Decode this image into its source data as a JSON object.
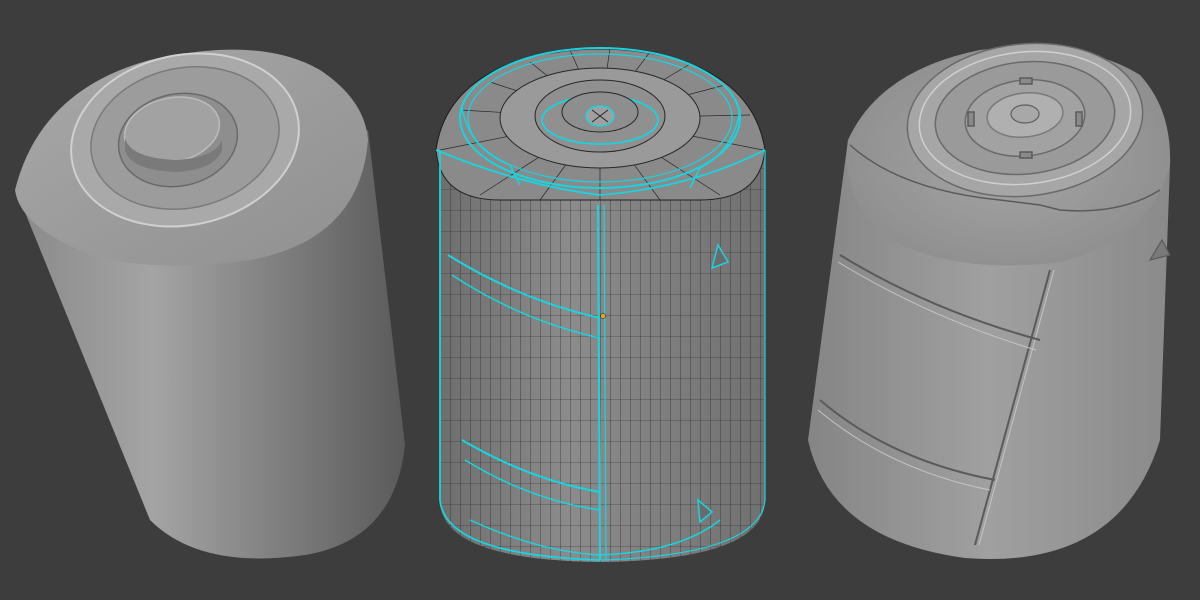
{
  "scene": {
    "background_color": "#3d3d3d",
    "objects": [
      {
        "id": "can-left",
        "description_icon": "cylinder-mesh-icon",
        "mode": "smooth-shaded"
      },
      {
        "id": "can-middle",
        "description_icon": "wireframe-mesh-icon",
        "mode": "edit-mode",
        "seam_color": "#19d4e0",
        "wire_color": "#1e1e1e",
        "origin_color": "#f0a020"
      },
      {
        "id": "can-right",
        "description_icon": "cylinder-mesh-icon",
        "mode": "smooth-shaded-detailed"
      }
    ],
    "mesh_colors": {
      "base": "#9a9a9a",
      "highlight": "#c8c8c8",
      "shadow": "#5e5e5e",
      "rim": "#d8d8d8"
    }
  }
}
